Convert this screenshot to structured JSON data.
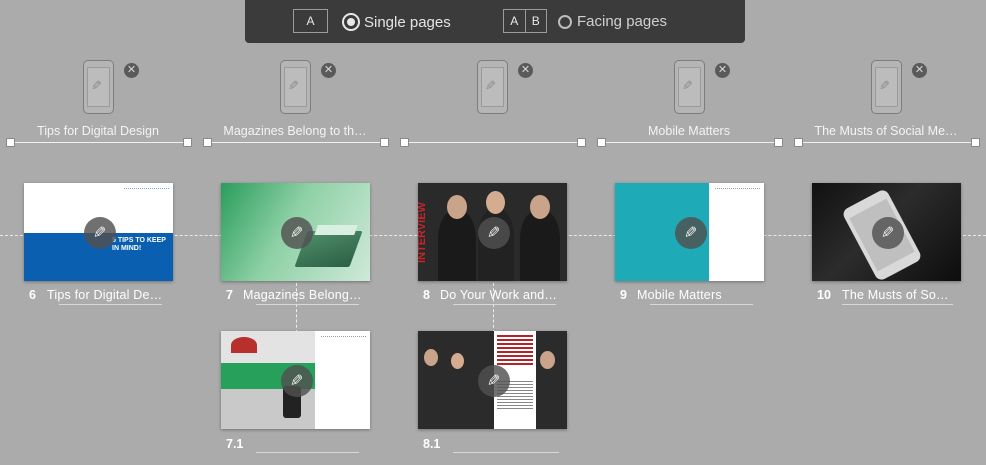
{
  "layout_toggle": {
    "single_box": "A",
    "facing_box_left": "A",
    "facing_box_right": "B",
    "single_label": "Single pages",
    "facing_label": "Facing pages",
    "selected": "single"
  },
  "sections": [
    {
      "title": "Tips for Digital Design"
    },
    {
      "title": "Magazines Belong to th…"
    },
    {
      "title": ""
    },
    {
      "title": "Mobile Matters"
    },
    {
      "title": "The Musts of Social Me…"
    }
  ],
  "pages": [
    {
      "number": "6",
      "title": "Tips for Digital De…",
      "thumb_text": "5 TIPS TO KEEP IN MIND!"
    },
    {
      "number": "7",
      "title": "Magazines Belong…"
    },
    {
      "number": "8",
      "title": "Do Your Work and…",
      "thumb_text": "INTERVIEW"
    },
    {
      "number": "9",
      "title": "Mobile Matters"
    },
    {
      "number": "10",
      "title": "The Musts of So…"
    },
    {
      "number": "7.1",
      "title": ""
    },
    {
      "number": "8.1",
      "title": ""
    }
  ],
  "icons": {
    "edit": "pencil-icon",
    "remove": "close-icon",
    "device": "mobile-device-icon"
  },
  "colors": {
    "background": "#ababab",
    "toolbar": "#3b3b3b",
    "accent_blue": "#0a5fb0",
    "teal": "#1eaab7",
    "green": "#2a9d5b"
  }
}
